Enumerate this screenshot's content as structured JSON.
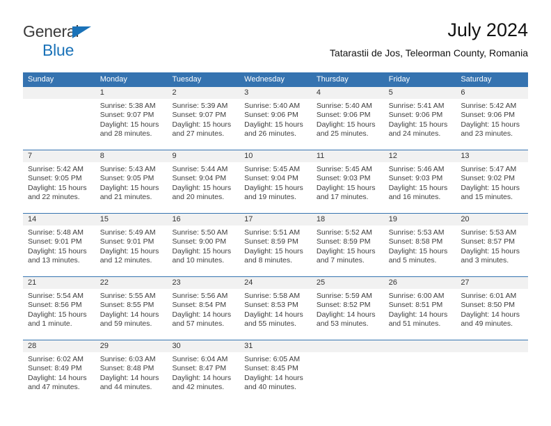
{
  "brand": {
    "line1": "General",
    "line2": "Blue",
    "triangle_icon": "triangle-icon"
  },
  "header": {
    "title": "July 2024",
    "subtitle": "Tatarastii de Jos, Teleorman County, Romania"
  },
  "colors": {
    "header_blue": "#3573B0",
    "brand_blue": "#1A72B8",
    "daynum_band": "#F1F1F1",
    "text": "#3D3D3D"
  },
  "calendar": {
    "weekday_headers": [
      "Sunday",
      "Monday",
      "Tuesday",
      "Wednesday",
      "Thursday",
      "Friday",
      "Saturday"
    ],
    "weeks": [
      [
        {
          "day": "",
          "empty": true,
          "sunrise": "",
          "sunset": "",
          "daylight_line1": "",
          "daylight_line2": ""
        },
        {
          "day": "1",
          "sunrise": "Sunrise: 5:38 AM",
          "sunset": "Sunset: 9:07 PM",
          "daylight_line1": "Daylight: 15 hours",
          "daylight_line2": "and 28 minutes."
        },
        {
          "day": "2",
          "sunrise": "Sunrise: 5:39 AM",
          "sunset": "Sunset: 9:07 PM",
          "daylight_line1": "Daylight: 15 hours",
          "daylight_line2": "and 27 minutes."
        },
        {
          "day": "3",
          "sunrise": "Sunrise: 5:40 AM",
          "sunset": "Sunset: 9:06 PM",
          "daylight_line1": "Daylight: 15 hours",
          "daylight_line2": "and 26 minutes."
        },
        {
          "day": "4",
          "sunrise": "Sunrise: 5:40 AM",
          "sunset": "Sunset: 9:06 PM",
          "daylight_line1": "Daylight: 15 hours",
          "daylight_line2": "and 25 minutes."
        },
        {
          "day": "5",
          "sunrise": "Sunrise: 5:41 AM",
          "sunset": "Sunset: 9:06 PM",
          "daylight_line1": "Daylight: 15 hours",
          "daylight_line2": "and 24 minutes."
        },
        {
          "day": "6",
          "sunrise": "Sunrise: 5:42 AM",
          "sunset": "Sunset: 9:06 PM",
          "daylight_line1": "Daylight: 15 hours",
          "daylight_line2": "and 23 minutes."
        }
      ],
      [
        {
          "day": "7",
          "sunrise": "Sunrise: 5:42 AM",
          "sunset": "Sunset: 9:05 PM",
          "daylight_line1": "Daylight: 15 hours",
          "daylight_line2": "and 22 minutes."
        },
        {
          "day": "8",
          "sunrise": "Sunrise: 5:43 AM",
          "sunset": "Sunset: 9:05 PM",
          "daylight_line1": "Daylight: 15 hours",
          "daylight_line2": "and 21 minutes."
        },
        {
          "day": "9",
          "sunrise": "Sunrise: 5:44 AM",
          "sunset": "Sunset: 9:04 PM",
          "daylight_line1": "Daylight: 15 hours",
          "daylight_line2": "and 20 minutes."
        },
        {
          "day": "10",
          "sunrise": "Sunrise: 5:45 AM",
          "sunset": "Sunset: 9:04 PM",
          "daylight_line1": "Daylight: 15 hours",
          "daylight_line2": "and 19 minutes."
        },
        {
          "day": "11",
          "sunrise": "Sunrise: 5:45 AM",
          "sunset": "Sunset: 9:03 PM",
          "daylight_line1": "Daylight: 15 hours",
          "daylight_line2": "and 17 minutes."
        },
        {
          "day": "12",
          "sunrise": "Sunrise: 5:46 AM",
          "sunset": "Sunset: 9:03 PM",
          "daylight_line1": "Daylight: 15 hours",
          "daylight_line2": "and 16 minutes."
        },
        {
          "day": "13",
          "sunrise": "Sunrise: 5:47 AM",
          "sunset": "Sunset: 9:02 PM",
          "daylight_line1": "Daylight: 15 hours",
          "daylight_line2": "and 15 minutes."
        }
      ],
      [
        {
          "day": "14",
          "sunrise": "Sunrise: 5:48 AM",
          "sunset": "Sunset: 9:01 PM",
          "daylight_line1": "Daylight: 15 hours",
          "daylight_line2": "and 13 minutes."
        },
        {
          "day": "15",
          "sunrise": "Sunrise: 5:49 AM",
          "sunset": "Sunset: 9:01 PM",
          "daylight_line1": "Daylight: 15 hours",
          "daylight_line2": "and 12 minutes."
        },
        {
          "day": "16",
          "sunrise": "Sunrise: 5:50 AM",
          "sunset": "Sunset: 9:00 PM",
          "daylight_line1": "Daylight: 15 hours",
          "daylight_line2": "and 10 minutes."
        },
        {
          "day": "17",
          "sunrise": "Sunrise: 5:51 AM",
          "sunset": "Sunset: 8:59 PM",
          "daylight_line1": "Daylight: 15 hours",
          "daylight_line2": "and 8 minutes."
        },
        {
          "day": "18",
          "sunrise": "Sunrise: 5:52 AM",
          "sunset": "Sunset: 8:59 PM",
          "daylight_line1": "Daylight: 15 hours",
          "daylight_line2": "and 7 minutes."
        },
        {
          "day": "19",
          "sunrise": "Sunrise: 5:53 AM",
          "sunset": "Sunset: 8:58 PM",
          "daylight_line1": "Daylight: 15 hours",
          "daylight_line2": "and 5 minutes."
        },
        {
          "day": "20",
          "sunrise": "Sunrise: 5:53 AM",
          "sunset": "Sunset: 8:57 PM",
          "daylight_line1": "Daylight: 15 hours",
          "daylight_line2": "and 3 minutes."
        }
      ],
      [
        {
          "day": "21",
          "sunrise": "Sunrise: 5:54 AM",
          "sunset": "Sunset: 8:56 PM",
          "daylight_line1": "Daylight: 15 hours",
          "daylight_line2": "and 1 minute."
        },
        {
          "day": "22",
          "sunrise": "Sunrise: 5:55 AM",
          "sunset": "Sunset: 8:55 PM",
          "daylight_line1": "Daylight: 14 hours",
          "daylight_line2": "and 59 minutes."
        },
        {
          "day": "23",
          "sunrise": "Sunrise: 5:56 AM",
          "sunset": "Sunset: 8:54 PM",
          "daylight_line1": "Daylight: 14 hours",
          "daylight_line2": "and 57 minutes."
        },
        {
          "day": "24",
          "sunrise": "Sunrise: 5:58 AM",
          "sunset": "Sunset: 8:53 PM",
          "daylight_line1": "Daylight: 14 hours",
          "daylight_line2": "and 55 minutes."
        },
        {
          "day": "25",
          "sunrise": "Sunrise: 5:59 AM",
          "sunset": "Sunset: 8:52 PM",
          "daylight_line1": "Daylight: 14 hours",
          "daylight_line2": "and 53 minutes."
        },
        {
          "day": "26",
          "sunrise": "Sunrise: 6:00 AM",
          "sunset": "Sunset: 8:51 PM",
          "daylight_line1": "Daylight: 14 hours",
          "daylight_line2": "and 51 minutes."
        },
        {
          "day": "27",
          "sunrise": "Sunrise: 6:01 AM",
          "sunset": "Sunset: 8:50 PM",
          "daylight_line1": "Daylight: 14 hours",
          "daylight_line2": "and 49 minutes."
        }
      ],
      [
        {
          "day": "28",
          "sunrise": "Sunrise: 6:02 AM",
          "sunset": "Sunset: 8:49 PM",
          "daylight_line1": "Daylight: 14 hours",
          "daylight_line2": "and 47 minutes."
        },
        {
          "day": "29",
          "sunrise": "Sunrise: 6:03 AM",
          "sunset": "Sunset: 8:48 PM",
          "daylight_line1": "Daylight: 14 hours",
          "daylight_line2": "and 44 minutes."
        },
        {
          "day": "30",
          "sunrise": "Sunrise: 6:04 AM",
          "sunset": "Sunset: 8:47 PM",
          "daylight_line1": "Daylight: 14 hours",
          "daylight_line2": "and 42 minutes."
        },
        {
          "day": "31",
          "sunrise": "Sunrise: 6:05 AM",
          "sunset": "Sunset: 8:45 PM",
          "daylight_line1": "Daylight: 14 hours",
          "daylight_line2": "and 40 minutes."
        },
        {
          "day": "",
          "empty": true,
          "sunrise": "",
          "sunset": "",
          "daylight_line1": "",
          "daylight_line2": ""
        },
        {
          "day": "",
          "empty": true,
          "sunrise": "",
          "sunset": "",
          "daylight_line1": "",
          "daylight_line2": ""
        },
        {
          "day": "",
          "empty": true,
          "sunrise": "",
          "sunset": "",
          "daylight_line1": "",
          "daylight_line2": ""
        }
      ]
    ]
  }
}
